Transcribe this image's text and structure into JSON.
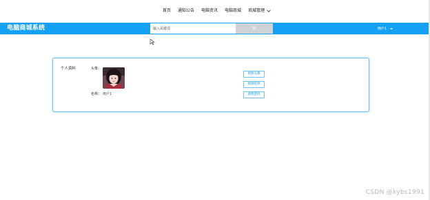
{
  "nav": {
    "items": [
      "首页",
      "通知公告",
      "电脑资讯",
      "电脑商城"
    ],
    "dropdown_label": "商城管理"
  },
  "header": {
    "brand": "电脑商城系统",
    "search_placeholder": "输入关键词",
    "search_button": "搜",
    "user_name": "用户1"
  },
  "profile": {
    "title": "个人资料",
    "avatar_label": "头像：",
    "nickname_label": "名称：",
    "nickname_value": "用户1",
    "buttons": {
      "change_avatar": "修改头像",
      "change_nickname": "修改昵称",
      "change_password": "修改密码"
    }
  },
  "watermark": "CSDN @kybs1991",
  "colors": {
    "accent": "#16a2f4",
    "search_button_bg": "#cfd3d8",
    "card_border": "#6cc2f2"
  },
  "icons": {
    "dropdown": "chevron-down-icon",
    "user_caret": "caret-down-icon",
    "cursor": "mouse-cursor-icon"
  }
}
